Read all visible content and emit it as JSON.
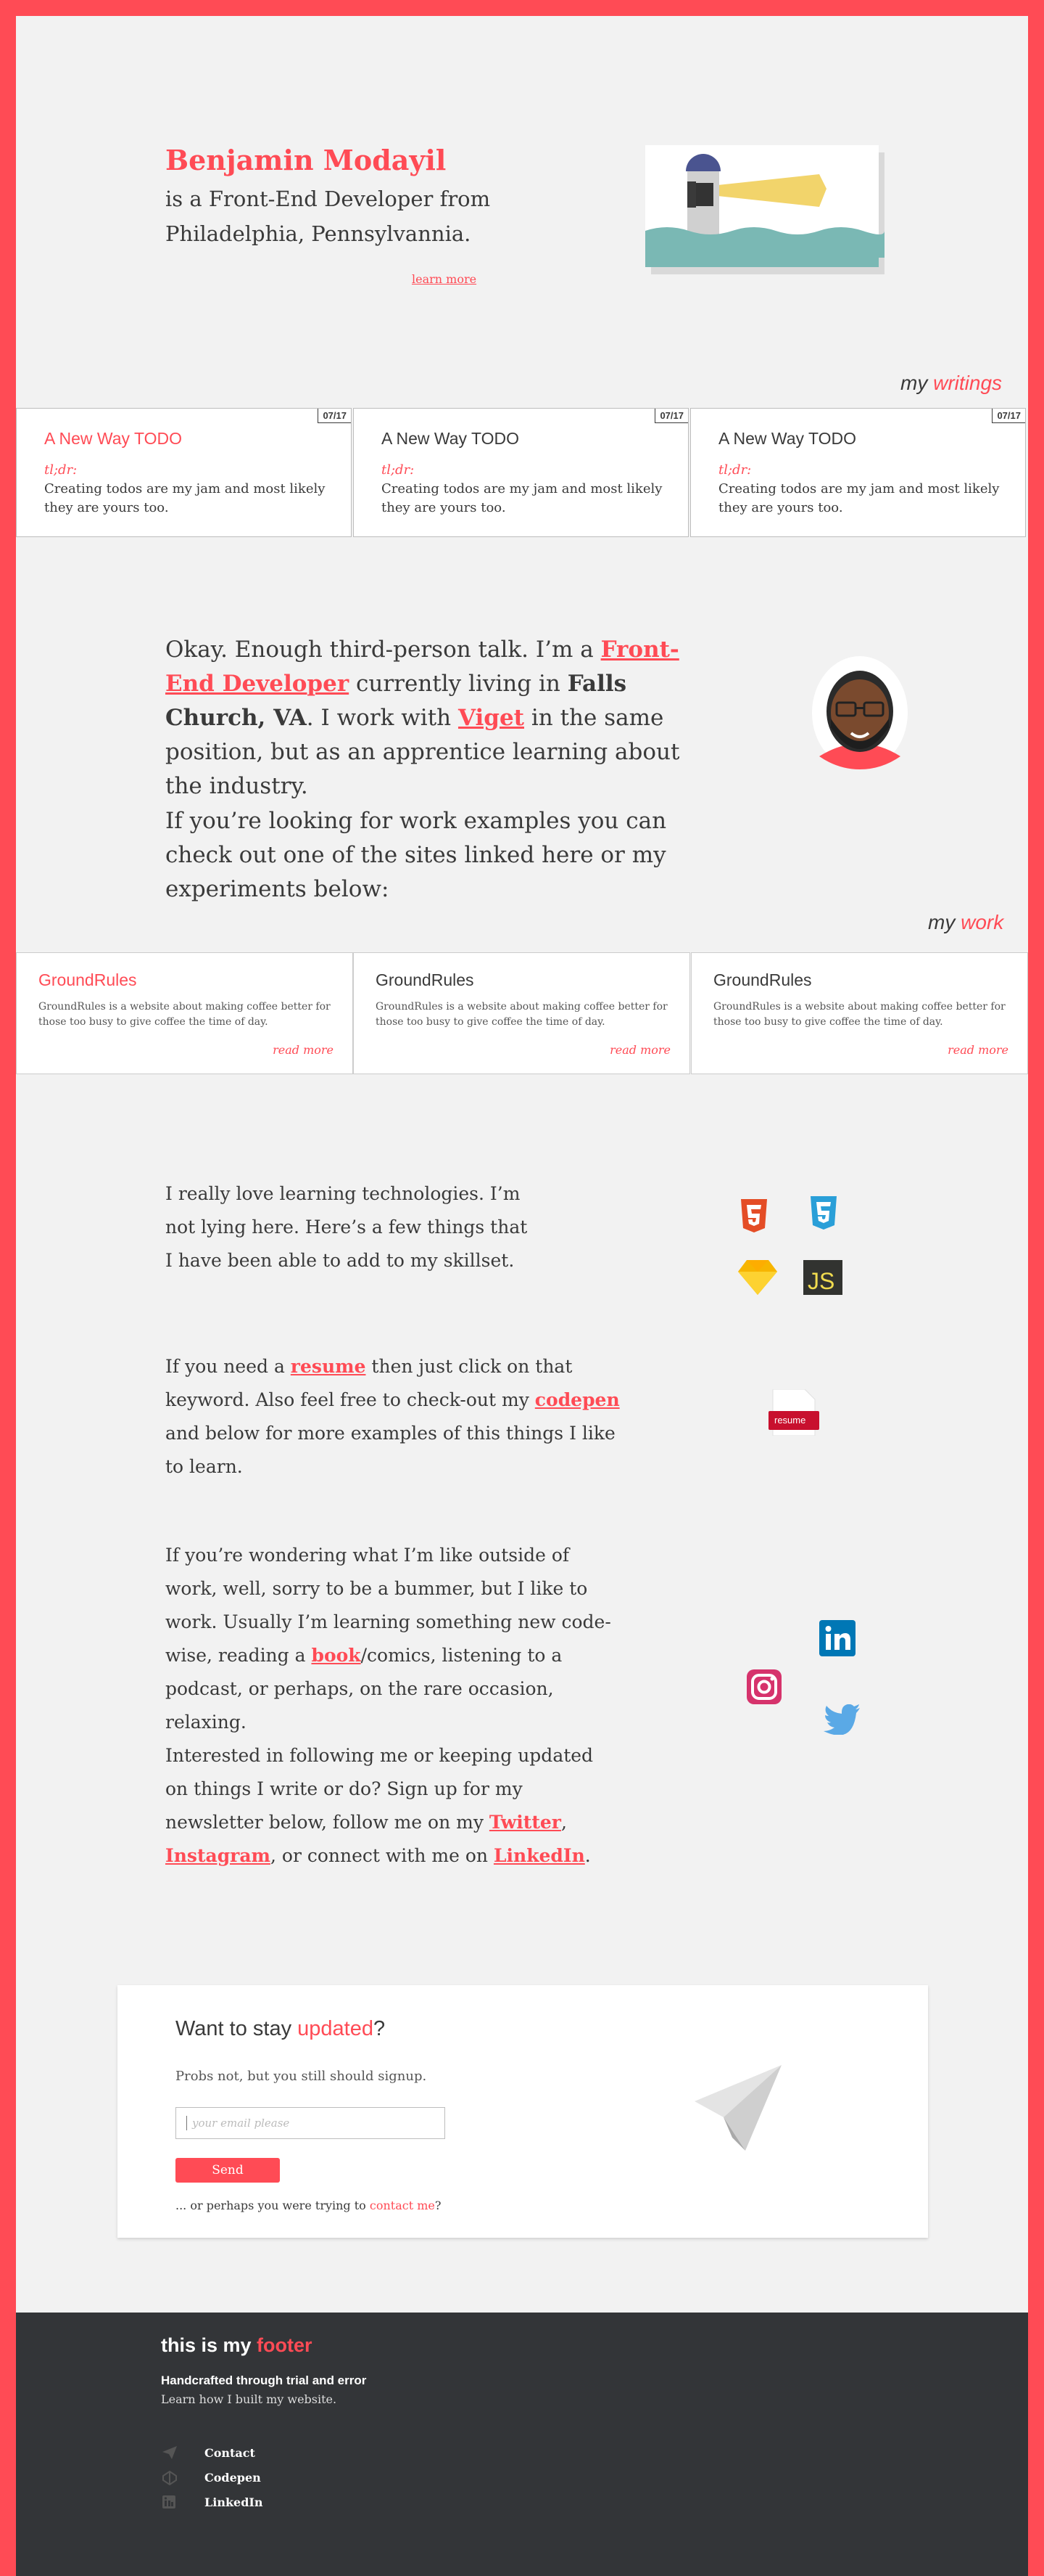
{
  "hero": {
    "name": "Benjamin Modayil",
    "line1": "is a Front-End Developer from",
    "line2": "Philadelphia, Pennsylvannia.",
    "learn_more": "learn more"
  },
  "writings": {
    "heading_prefix": "my",
    "heading_accent": "writings",
    "cards": [
      {
        "date": "07/17",
        "title": "A New Way TODO",
        "tldr": "tl;dr:",
        "desc": "Creating todos are my jam and most likely they are yours too."
      },
      {
        "date": "07/17",
        "title": "A New Way TODO",
        "tldr": "tl;dr:",
        "desc": "Creating todos are my jam and most likely they are yours too."
      },
      {
        "date": "07/17",
        "title": "A New Way TODO",
        "tldr": "tl;dr:",
        "desc": "Creating todos are my jam and most likely they are yours too."
      }
    ]
  },
  "about": {
    "p1_a": "Okay. Enough third-person talk. I’m a ",
    "p1_link1": "Front-End Developer",
    "p1_b": " currently living in ",
    "p1_bold": "Falls Church, VA",
    "p1_c": ". I work with ",
    "p1_link2": "Viget",
    "p1_d": " in the same position, but as an apprentice learning about the industry.",
    "p2": "If you’re looking for work examples you can check out one of the sites linked here or my experiments below:"
  },
  "work": {
    "heading_prefix": "my",
    "heading_accent": "work",
    "cards": [
      {
        "title": "GroundRules",
        "desc": "GroundRules is a website about making coffee better for those too busy to give coffee the time of day.",
        "more": "read more"
      },
      {
        "title": "GroundRules",
        "desc": "GroundRules is a website about making coffee better for those too busy to give coffee the time of day.",
        "more": "read more"
      },
      {
        "title": "GroundRules",
        "desc": "GroundRules is a website about making coffee better for those too busy to give coffee the time of day.",
        "more": "read more"
      }
    ]
  },
  "skills": {
    "p1": "I really love learning technologies. I’m not lying here. Here’s a few things that I have been able to add to my skillset.",
    "icons": [
      "html5-icon",
      "css3-icon",
      "sketch-icon",
      "js-icon"
    ]
  },
  "resume": {
    "a": "If you need a ",
    "link1": "resume",
    "b": " then just click on that keyword. Also feel free to check-out my ",
    "link2": "codepen",
    "c": " and below for more examples of this things I like to learn.",
    "badge": "resume"
  },
  "outside": {
    "a": "If you’re wondering what I’m like outside of work, well, sorry to be a bummer, but I like to work. Usually I’m learning something new code-wise, reading a ",
    "link": "book",
    "b": "/comics, listening to a podcast, or perhaps, on the rare occasion, relaxing."
  },
  "follow": {
    "a": "Interested in following me or keeping updated on things I write or do? Sign up for my newsletter below, follow me on my ",
    "link1": "Twitter",
    "b": ", ",
    "link2": "Instagram",
    "c": ", or connect with me on ",
    "link3": "LinkedIn",
    "d": "."
  },
  "newsletter": {
    "title_a": "Want to stay ",
    "title_accent": "updated",
    "title_b": "?",
    "sub": "Probs not, but you still should signup.",
    "placeholder": "your email please",
    "send": "Send",
    "contact_a": "... or perhaps you were trying to ",
    "contact_link": "contact me",
    "contact_b": "?"
  },
  "footer": {
    "title_a": "this is my ",
    "title_accent": "footer",
    "tag": "Handcrafted through trial and error",
    "learn": "Learn how I built my website.",
    "links": [
      "Contact",
      "Codepen",
      "LinkedIn"
    ]
  },
  "colors": {
    "accent": "#ff4b55",
    "footer_bg": "#333538",
    "text": "#3a3a3a"
  }
}
